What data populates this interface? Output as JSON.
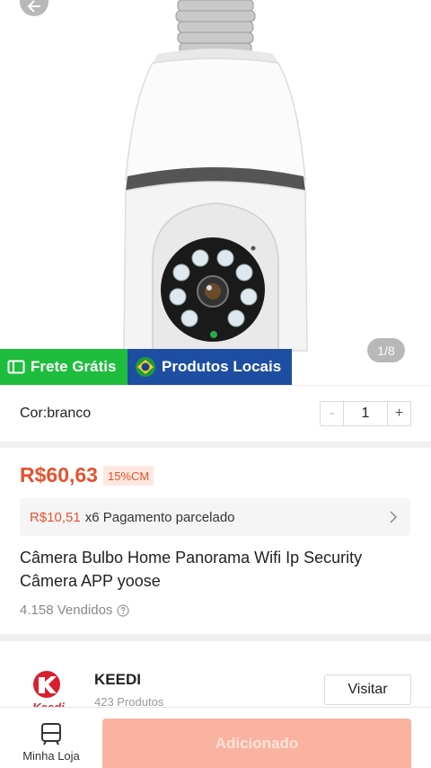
{
  "gallery": {
    "counter": "1/8"
  },
  "badges": {
    "frete": "Frete Grátis",
    "locais": "Produtos Locais"
  },
  "variant": {
    "label": "Cor:branco",
    "quantity": "1",
    "minus": "-",
    "plus": "+"
  },
  "pricing": {
    "price": "R$60,63",
    "discount": "15%CM",
    "installment_amount": "R$10,51",
    "installment_text": "x6 Pagamento parcelado"
  },
  "product": {
    "title": "Câmera Bulbo Home Panorama Wifi Ip Security Câmera APP yoose",
    "sold": "4.158 Vendidos"
  },
  "store": {
    "name": "KEEDI",
    "products": "423 Produtos",
    "logo_text": "Keedi",
    "visit_label": "Visitar"
  },
  "bottom_bar": {
    "shop_label": "Minha Loja",
    "add_label": "Adicionado"
  },
  "colors": {
    "accent": "#e4522c",
    "frete_green": "#1ebd3e",
    "locais_blue": "#1d4ea1",
    "add_button": "#f9b3a0"
  }
}
